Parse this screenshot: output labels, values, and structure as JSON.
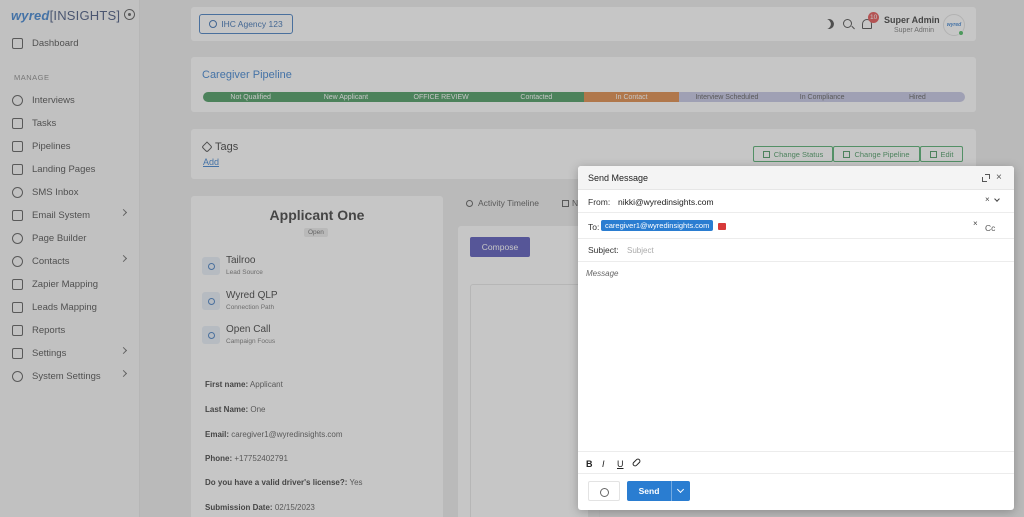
{
  "sidebar": {
    "logo_wyred": "wyred",
    "logo_insights": "[INSIGHTS]",
    "section_label": "MANAGE",
    "items": [
      {
        "label": "Dashboard"
      },
      {
        "label": "Interviews"
      },
      {
        "label": "Tasks"
      },
      {
        "label": "Pipelines"
      },
      {
        "label": "Landing Pages"
      },
      {
        "label": "SMS Inbox"
      },
      {
        "label": "Email System"
      },
      {
        "label": "Page Builder"
      },
      {
        "label": "Contacts"
      },
      {
        "label": "Zapier Mapping"
      },
      {
        "label": "Leads Mapping"
      },
      {
        "label": "Reports"
      },
      {
        "label": "Settings"
      },
      {
        "label": "System Settings"
      }
    ]
  },
  "topbar": {
    "agency": "IHC Agency 123",
    "notifications": "10",
    "user_name": "Super Admin",
    "user_role": "Super Admin",
    "avatar_text": "wyred"
  },
  "pipeline": {
    "title": "Caregiver Pipeline",
    "stages": [
      {
        "label": "Not Qualified",
        "color": "#2e8b47"
      },
      {
        "label": "New Applicant",
        "color": "#2e8b47"
      },
      {
        "label": "OFFICE REVIEW",
        "color": "#2e8b47"
      },
      {
        "label": "Contacted",
        "color": "#2e8b47"
      },
      {
        "label": "In Contact",
        "color": "#d9772b"
      },
      {
        "label": "Interview Scheduled",
        "color": "#bcbde0"
      },
      {
        "label": "In Compliance",
        "color": "#bcbde0"
      },
      {
        "label": "Hired",
        "color": "#bcbde0"
      }
    ]
  },
  "tags": {
    "title": "Tags",
    "add": "Add",
    "change_status": "Change Status",
    "change_pipeline": "Change Pipeline",
    "edit": "Edit"
  },
  "applicant": {
    "name": "Applicant One",
    "status": "Open",
    "lead_source": "Tailroo",
    "lead_source_label": "Lead Source",
    "connection_path": "Wyred QLP",
    "connection_path_label": "Connection Path",
    "campaign_focus": "Open Call",
    "campaign_focus_label": "Campaign Focus",
    "fields": [
      {
        "label": "First name:",
        "value": "Applicant"
      },
      {
        "label": "Last Name:",
        "value": "One"
      },
      {
        "label": "Email:",
        "value": "caregiver1@wyredinsights.com"
      },
      {
        "label": "Phone:",
        "value": "+17752402791"
      },
      {
        "label": "Do you have a valid driver's license?:",
        "value": "Yes"
      },
      {
        "label": "Submission Date:",
        "value": "02/15/2023"
      }
    ]
  },
  "content": {
    "tab_activity": "Activity Timeline",
    "tab_second": "N",
    "compose": "Compose"
  },
  "modal": {
    "title": "Send Message",
    "close": "×",
    "from_label": "From:",
    "from_value": "nikki@wyredinsights.com",
    "from_clear": "×",
    "to_label": "To:",
    "to_chip": "caregiver1@wyredinsights.com",
    "to_clear": "×",
    "cc": "Cc",
    "subject_label": "Subject:",
    "subject_placeholder": "Subject",
    "message_placeholder": "Message",
    "bold": "B",
    "italic": "I",
    "underline": "U",
    "send": "Send"
  }
}
